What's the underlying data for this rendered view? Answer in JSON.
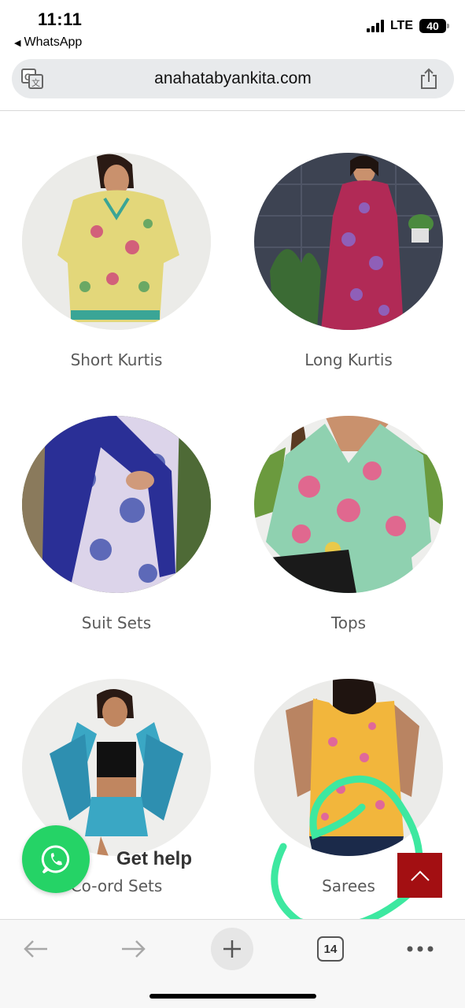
{
  "status_bar": {
    "time": "11:11",
    "back_app": "WhatsApp",
    "network": "LTE",
    "battery": "40"
  },
  "browser": {
    "url": "anahatabyankita.com",
    "tab_count": "14",
    "icons": [
      "translate-icon",
      "share-icon",
      "back-arrow-icon",
      "forward-arrow-icon",
      "plus-icon",
      "tabs-icon",
      "more-icon"
    ]
  },
  "categories": [
    {
      "label": "Short Kurtis"
    },
    {
      "label": "Long Kurtis"
    },
    {
      "label": "Suit Sets"
    },
    {
      "label": "Tops"
    },
    {
      "label": "Co-ord Sets"
    },
    {
      "label": "Sarees"
    }
  ],
  "floating": {
    "get_help": "Get help"
  },
  "colors": {
    "whatsapp_green": "#25d366",
    "scroll_top_red": "#a30f12",
    "annotation_green": "#3de8a0"
  }
}
